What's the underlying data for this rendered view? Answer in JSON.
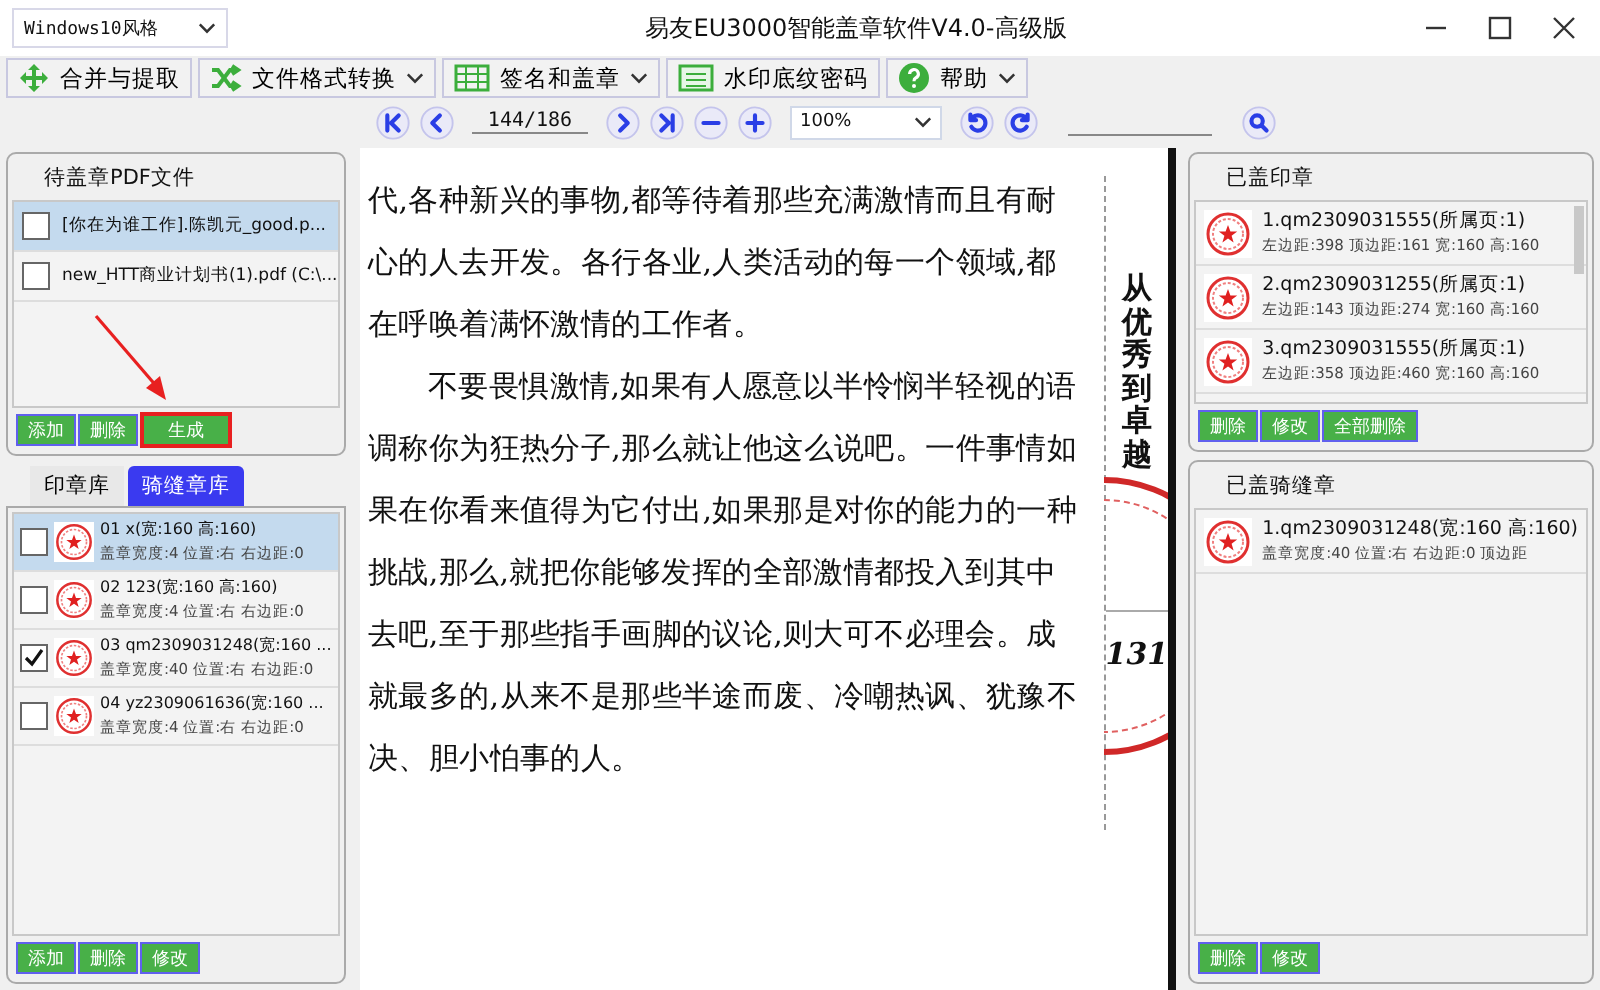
{
  "window": {
    "title": "易友EU3000智能盖章软件V4.0-高级版",
    "style_select": "Windows10风格"
  },
  "toolbar": [
    {
      "label": "合并与提取",
      "kind": "plain"
    },
    {
      "label": "文件格式转换",
      "kind": "menu"
    },
    {
      "label": "签名和盖章",
      "kind": "menu"
    },
    {
      "label": "水印底纹密码",
      "kind": "plain"
    },
    {
      "label": "帮助",
      "kind": "menu"
    }
  ],
  "navigation": {
    "page": "144/186",
    "zoom": "100%"
  },
  "files": {
    "title": "待盖章PDF文件",
    "items": [
      {
        "name": "[你在为谁工作].陈凯元_good.p...",
        "checked": false,
        "selected": true
      },
      {
        "name": "new_HTT商业计划书(1).pdf (C:\\...",
        "checked": false,
        "selected": false
      }
    ],
    "buttons": [
      {
        "label": "添加",
        "highlighted": false
      },
      {
        "label": "删除",
        "highlighted": false
      },
      {
        "label": "生成",
        "highlighted": true
      }
    ]
  },
  "library": {
    "tabs": [
      {
        "label": "印章库",
        "selected": false
      },
      {
        "label": "骑缝章库",
        "selected": true
      }
    ],
    "items": [
      {
        "name": "01 x(宽:160 高:160)",
        "detail": "盖章宽度:4 位置:右 右边距:0",
        "checked": false,
        "selected": true
      },
      {
        "name": "02 123(宽:160 高:160)",
        "detail": "盖章宽度:4 位置:右 右边距:0",
        "checked": false,
        "selected": false
      },
      {
        "name": "03 qm2309031248(宽:160 ...",
        "detail": "盖章宽度:40 位置:右 右边距:0",
        "checked": true,
        "selected": false
      },
      {
        "name": "04 yz2309061636(宽:160 ...",
        "detail": "盖章宽度:4 位置:右 右边距:0",
        "checked": false,
        "selected": false
      }
    ],
    "buttons": [
      "添加",
      "删除",
      "修改"
    ]
  },
  "document": {
    "paragraphs": [
      {
        "continued": true,
        "lines": [
          "代,各种新兴的事物,都等待着那些充满激情而且有耐",
          "心的人去开发。各行各业,人类活动的每一个领域,都",
          "在呼唤着满怀激情的工作者。"
        ]
      },
      {
        "continued": false,
        "lines": [
          "不要畏惧激情,如果有人愿意以半怜悯半轻视的语",
          "调称你为狂热分子,那么就让他这么说吧。一件事情如",
          "果在你看来值得为它付出,如果那是对你的能力的一种",
          "挑战,那么,就把你能够发挥的全部激情都投入到其中",
          "去吧,至于那些指手画脚的议论,则大可不必理会。成",
          "就最多的,从来不是那些半途而废、冷嘲热讽、犹豫不",
          "决、胆小怕事的人。"
        ]
      }
    ],
    "side_heading": "从优秀到卓越",
    "page_number": "131"
  },
  "placed_stamps": {
    "title": "已盖印章",
    "items": [
      {
        "name": "1.qm2309031555(所属页:1)",
        "detail": "左边距:398 顶边距:161 宽:160 高:160"
      },
      {
        "name": "2.qm2309031255(所属页:1)",
        "detail": "左边距:143 顶边距:274 宽:160 高:160"
      },
      {
        "name": "3.qm2309031555(所属页:1)",
        "detail": "左边距:358 顶边距:460 宽:160 高:160"
      }
    ],
    "buttons": [
      "删除",
      "修改",
      "全部删除"
    ]
  },
  "placed_seams": {
    "title": "已盖骑缝章",
    "items": [
      {
        "name": "1.qm2309031248(宽:160 高:160)",
        "detail": "盖章宽度:40 位置:右 右边距:0 顶边距"
      }
    ],
    "buttons": [
      "删除",
      "修改"
    ]
  }
}
